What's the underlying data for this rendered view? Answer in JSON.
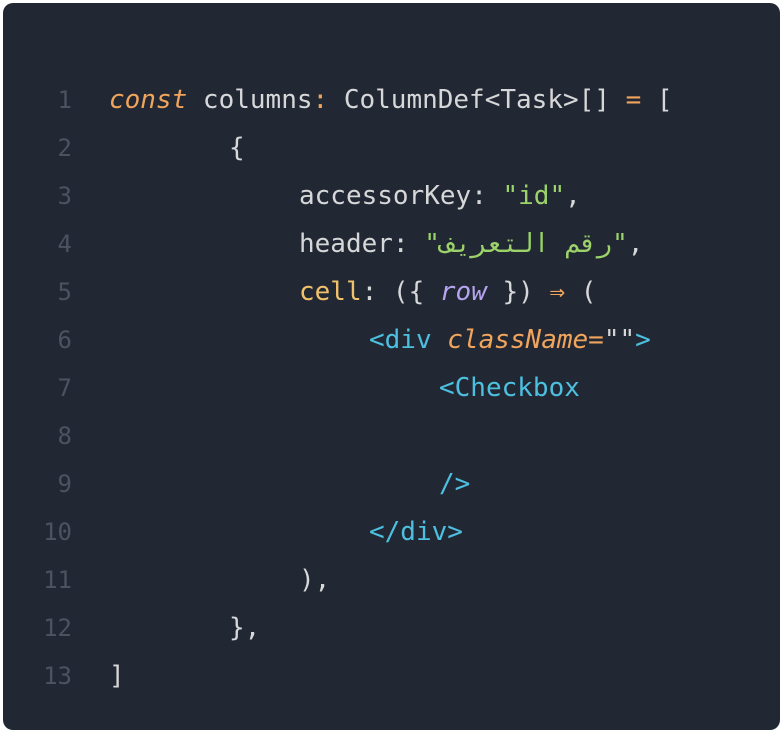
{
  "code": {
    "lines": [
      {
        "number": "1",
        "tokens": [
          {
            "text": "const",
            "type": "keyword"
          },
          {
            "text": " columns",
            "type": "ident"
          },
          {
            "text": ":",
            "type": "op"
          },
          {
            "text": " ColumnDef<Task>[]",
            "type": "ident"
          },
          {
            "text": " =",
            "type": "op"
          },
          {
            "text": " [",
            "type": "punct"
          }
        ]
      },
      {
        "number": "2",
        "tokens": [
          {
            "text": "{",
            "type": "punct"
          }
        ]
      },
      {
        "number": "3",
        "tokens": [
          {
            "text": "accessorKey",
            "type": "prop"
          },
          {
            "text": ": ",
            "type": "punct"
          },
          {
            "text": "\"id\"",
            "type": "string"
          },
          {
            "text": ",",
            "type": "punct"
          }
        ]
      },
      {
        "number": "4",
        "tokens": [
          {
            "text": "header",
            "type": "prop"
          },
          {
            "text": ": ",
            "type": "punct"
          },
          {
            "text": "\"رقم التعريف\"",
            "type": "string"
          },
          {
            "text": ",",
            "type": "punct"
          }
        ]
      },
      {
        "number": "5",
        "tokens": [
          {
            "text": "cell",
            "type": "fnprop"
          },
          {
            "text": ": ({ ",
            "type": "punct"
          },
          {
            "text": "row",
            "type": "param"
          },
          {
            "text": " }) ",
            "type": "punct"
          },
          {
            "text": "⇒",
            "type": "op"
          },
          {
            "text": " (",
            "type": "punct"
          }
        ]
      },
      {
        "number": "6",
        "tokens": [
          {
            "text": "<div ",
            "type": "tag"
          },
          {
            "text": "className",
            "type": "attr"
          },
          {
            "text": "=",
            "type": "op"
          },
          {
            "text": "\"\"",
            "type": "punct"
          },
          {
            "text": ">",
            "type": "tag"
          }
        ]
      },
      {
        "number": "7",
        "tokens": [
          {
            "text": "<Checkbox",
            "type": "tag"
          }
        ]
      },
      {
        "number": "8",
        "tokens": []
      },
      {
        "number": "9",
        "tokens": [
          {
            "text": "/>",
            "type": "tag"
          }
        ]
      },
      {
        "number": "10",
        "tokens": [
          {
            "text": "</div>",
            "type": "tag"
          }
        ]
      },
      {
        "number": "11",
        "tokens": [
          {
            "text": "),",
            "type": "punct"
          }
        ]
      },
      {
        "number": "12",
        "tokens": [
          {
            "text": "},",
            "type": "punct"
          }
        ]
      },
      {
        "number": "13",
        "tokens": [
          {
            "text": "]",
            "type": "punct"
          }
        ]
      }
    ]
  },
  "theme": {
    "background": "#222833",
    "line_number": "#4b5361",
    "keyword": "#f0a45c",
    "string": "#9bd36a",
    "tag": "#4dc0e0",
    "param": "#b6a4f0",
    "function_prop": "#f2c26b",
    "text": "#d6d7d9"
  }
}
